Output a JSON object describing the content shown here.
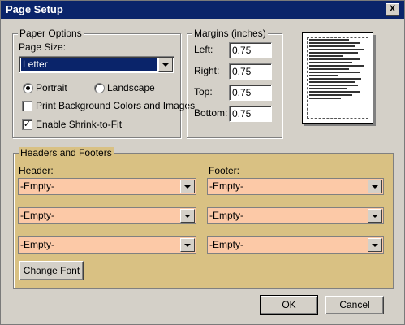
{
  "window": {
    "title": "Page Setup",
    "close_label": "X"
  },
  "paper_options": {
    "legend": "Paper Options",
    "page_size_label": "Page Size:",
    "page_size_value": "Letter",
    "portrait_label": "Portrait",
    "landscape_label": "Landscape",
    "orientation_selected": "Portrait",
    "print_bg_label": "Print Background Colors and Images",
    "print_bg_checked": false,
    "shrink_label": "Enable Shrink-to-Fit",
    "shrink_checked": true,
    "check_mark": "✓"
  },
  "margins": {
    "legend": "Margins (inches)",
    "left_label": "Left:",
    "left_value": "0.75",
    "right_label": "Right:",
    "right_value": "0.75",
    "top_label": "Top:",
    "top_value": "0.75",
    "bottom_label": "Bottom:",
    "bottom_value": "0.75"
  },
  "headers_footers": {
    "legend": "Headers and Footers",
    "header_label": "Header:",
    "footer_label": "Footer:",
    "header_values": [
      "-Empty-",
      "-Empty-",
      "-Empty-"
    ],
    "footer_values": [
      "-Empty-",
      "-Empty-",
      "-Empty-"
    ],
    "change_font_label": "Change Font"
  },
  "buttons": {
    "ok_label": "OK",
    "cancel_label": "Cancel"
  },
  "colors": {
    "title_bar": "#0a246a",
    "headers_panel": "#d9c183",
    "dropdown_fill": "#fcc9a7",
    "dialog_bg": "#d4d0c8"
  }
}
